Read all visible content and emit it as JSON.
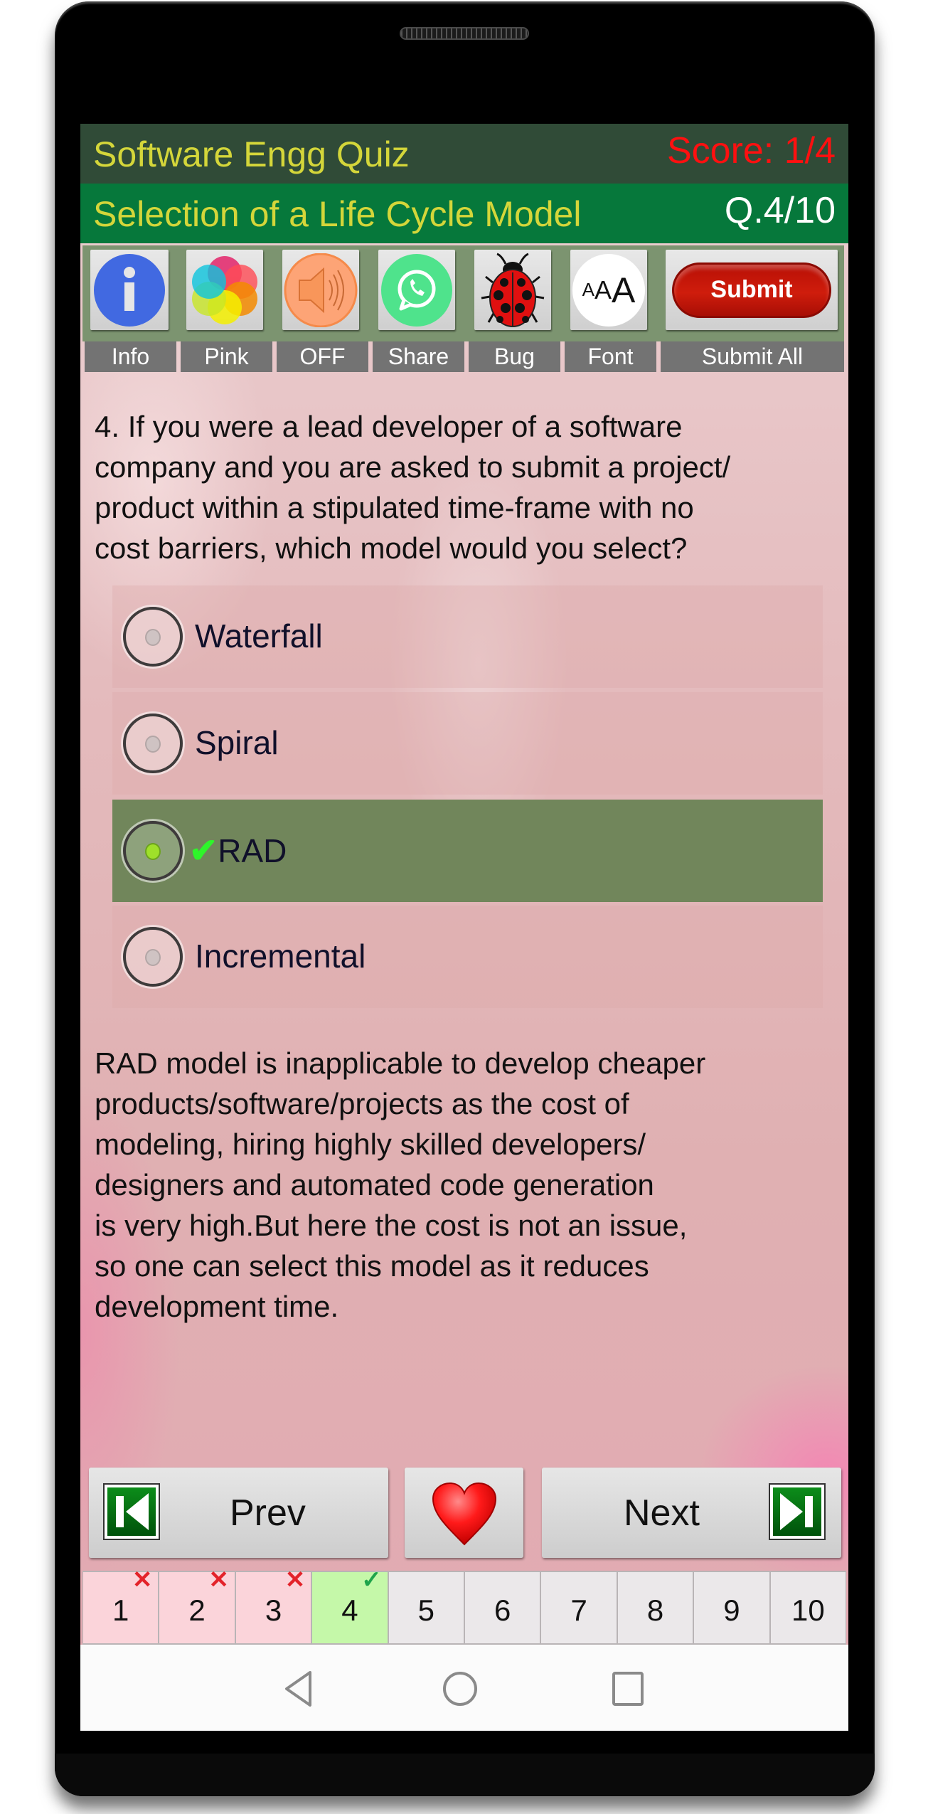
{
  "header": {
    "app_title": "Software Engg Quiz",
    "score": "Score: 1/4",
    "topic": "Selection of a Life Cycle Model",
    "question_counter": "Q.4/10"
  },
  "toolbar": {
    "buttons": [
      {
        "icon": "info-icon",
        "label": "Info"
      },
      {
        "icon": "color-palette-icon",
        "label": "Pink"
      },
      {
        "icon": "speaker-icon",
        "label": "OFF"
      },
      {
        "icon": "whatsapp-share-icon",
        "label": "Share"
      },
      {
        "icon": "ladybug-icon",
        "label": "Bug"
      },
      {
        "icon": "font-size-icon",
        "label": "Font",
        "glyph": "AAA"
      },
      {
        "icon": "submit-icon",
        "label": "Submit All",
        "button_text": "Submit"
      }
    ]
  },
  "question": {
    "text": "4. If you were a lead developer of a software\ncompany and you are asked to submit a project/\nproduct within a stipulated time-frame with no\ncost barriers, which model would you select?",
    "options": [
      {
        "label": "Waterfall",
        "selected": false
      },
      {
        "label": "Spiral",
        "selected": false
      },
      {
        "label": "RAD",
        "selected": true,
        "correct_mark": "✔"
      },
      {
        "label": "Incremental",
        "selected": false
      }
    ]
  },
  "explanation": "RAD model is inapplicable to develop cheaper\nproducts/software/projects as the cost of\nmodeling, hiring highly skilled developers/\ndesigners and automated code generation\nis very high.But here the cost is not an issue,\nso one can select this model as it reduces\ndevelopment time.",
  "navigation": {
    "prev_label": "Prev",
    "next_label": "Next",
    "favorite_icon": "heart-icon"
  },
  "pager": {
    "pages": [
      {
        "number": "1",
        "status": "wrong",
        "mark": "✕"
      },
      {
        "number": "2",
        "status": "wrong",
        "mark": "✕"
      },
      {
        "number": "3",
        "status": "wrong",
        "mark": "✕"
      },
      {
        "number": "4",
        "status": "right",
        "mark": "✓"
      },
      {
        "number": "5",
        "status": "unanswered",
        "mark": ""
      },
      {
        "number": "6",
        "status": "unanswered",
        "mark": ""
      },
      {
        "number": "7",
        "status": "unanswered",
        "mark": ""
      },
      {
        "number": "8",
        "status": "unanswered",
        "mark": ""
      },
      {
        "number": "9",
        "status": "unanswered",
        "mark": ""
      },
      {
        "number": "10",
        "status": "unanswered",
        "mark": ""
      }
    ]
  },
  "colors": {
    "title_bar": "#304b37",
    "topic_bar": "#06783b",
    "title_text": "#d4d63a",
    "score_text": "#ff1010",
    "selected_option": "#71865b",
    "correct_check": "#2ef52a",
    "wrong_page": "#fbd4da",
    "right_page": "#c5f8a9"
  }
}
